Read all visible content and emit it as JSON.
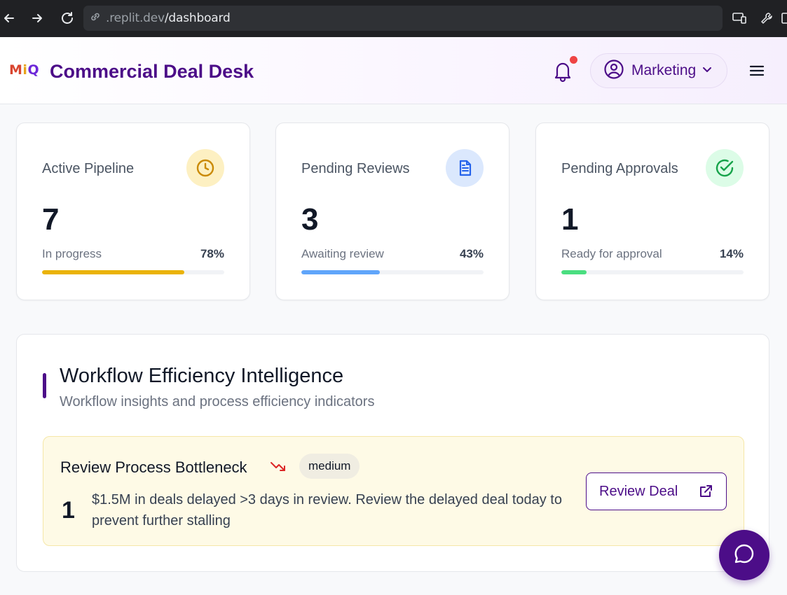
{
  "browser": {
    "url_host": ".replit.dev",
    "url_path": "/dashboard"
  },
  "header": {
    "logo_text": [
      "M",
      "i",
      "Q"
    ],
    "title": "Commercial Deal Desk",
    "role": "Marketing",
    "notification_dot_color": "#ef4444",
    "brand_color": "#4c0d88"
  },
  "stats": [
    {
      "label": "Active Pipeline",
      "value": "7",
      "sub": "In progress",
      "percent_label": "78%",
      "percent": 78,
      "icon": "clock-icon",
      "color": "#eab308",
      "icon_bg": "#fdf0c2"
    },
    {
      "label": "Pending Reviews",
      "value": "3",
      "sub": "Awaiting review",
      "percent_label": "43%",
      "percent": 43,
      "icon": "document-icon",
      "color": "#60a5fa",
      "icon_bg": "#dbe8fd"
    },
    {
      "label": "Pending Approvals",
      "value": "1",
      "sub": "Ready for approval",
      "percent_label": "14%",
      "percent": 14,
      "icon": "check-circle-icon",
      "color": "#4ade80",
      "icon_bg": "#dcfce7"
    }
  ],
  "workflow": {
    "title": "Workflow Efficiency Intelligence",
    "subtitle": "Workflow insights and process efficiency indicators",
    "alert": {
      "title": "Review Process Bottleneck",
      "severity": "medium",
      "count": "1",
      "message": "$1.5M in deals delayed >3 days in review. Review the delayed deal today to prevent further stalling",
      "action_label": "Review Deal",
      "trend_icon": "trending-down-icon"
    }
  },
  "chat": {
    "icon": "chat-bubble-icon"
  }
}
